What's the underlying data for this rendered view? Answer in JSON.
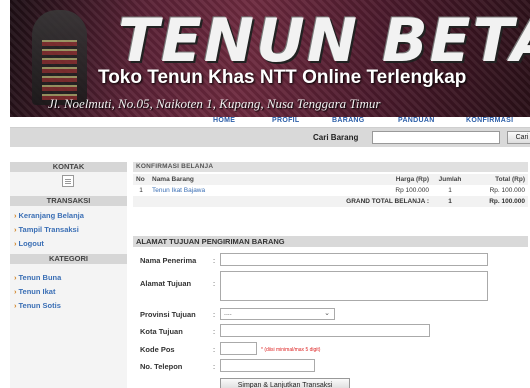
{
  "banner": {
    "title": "TENUN BETA",
    "subtitle": "Toko Tenun Khas NTT Online Terlengkap",
    "address": "Jl. Noelmuti, No.05, Naikoten 1, Kupang, Nusa Tenggara Timur"
  },
  "nav": {
    "items": [
      "HOME",
      "PROFIL",
      "BARANG",
      "PANDUAN",
      "KONFIRMASI"
    ]
  },
  "search": {
    "label": "Cari Barang",
    "value": "",
    "button": "Cari"
  },
  "sidebar": {
    "kontak_header": "KONTAK",
    "transaksi_header": "TRANSAKSI",
    "transaksi_links": [
      "Keranjang Belanja",
      "Tampil Transaksi",
      "Logout"
    ],
    "kategori_header": "KATEGORI",
    "kategori_links": [
      "Tenun Buna",
      "Tenun Ikat",
      "Tenun Sotis"
    ]
  },
  "cart": {
    "header": "KONFIRMASI BELANJA",
    "columns": [
      "No",
      "Nama Barang",
      "Harga (Rp)",
      "Jumlah",
      "Total (Rp)"
    ],
    "rows": [
      {
        "no": "1",
        "name": "Tenun Ikat Bajawa",
        "price": "Rp 100.000",
        "qty": "1",
        "total": "Rp. 100.000"
      }
    ],
    "grand_label": "GRAND TOTAL BELANJA :",
    "grand_qty": "1",
    "grand_total": "Rp. 100.000"
  },
  "address_form": {
    "header": "ALAMAT TUJUAN PENGIRIMAN BARANG",
    "colon": ":",
    "fields": {
      "nama_label": "Nama Penerima",
      "alamat_label": "Alamat Tujuan",
      "provinsi_label": "Provinsi Tujuan",
      "provinsi_value": "....",
      "kota_label": "Kota Tujuan",
      "kodepos_label": "Kode Pos",
      "kodepos_hint": "* (diisi minimal/max 5 digit)",
      "telepon_label": "No. Telepon"
    },
    "submit": "Simpan & Lanjutkan Transaksi"
  },
  "colors": {
    "link": "#3b6fb5",
    "banner": "#5a2236",
    "header_bar": "#d9d9d9"
  },
  "icons": [
    "document-icon",
    "chevron-right-icon",
    "dropdown-arrow-icon"
  ]
}
